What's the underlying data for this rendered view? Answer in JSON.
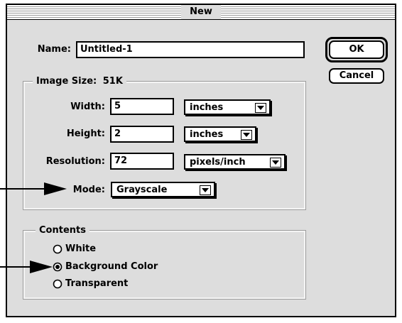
{
  "window": {
    "title": "New"
  },
  "name_row": {
    "label": "Name:",
    "value": "Untitled-1"
  },
  "buttons": {
    "ok": "OK",
    "cancel": "Cancel"
  },
  "image_size": {
    "title": "Image Size:",
    "size": "51K",
    "width": {
      "label": "Width:",
      "value": "5",
      "unit": "inches"
    },
    "height": {
      "label": "Height:",
      "value": "2",
      "unit": "inches"
    },
    "resolution": {
      "label": "Resolution:",
      "value": "72",
      "unit": "pixels/inch"
    },
    "mode": {
      "label": "Mode:",
      "value": "Grayscale"
    }
  },
  "contents": {
    "title": "Contents",
    "options": [
      {
        "label": "White",
        "selected": false
      },
      {
        "label": "Background Color",
        "selected": true
      },
      {
        "label": "Transparent",
        "selected": false
      }
    ]
  },
  "icons": {
    "popup_arrow": "down-triangle-icon",
    "callout_arrow": "right-arrow-icon",
    "radio_on": "radio-selected-icon",
    "radio_off": "radio-unselected-icon"
  }
}
